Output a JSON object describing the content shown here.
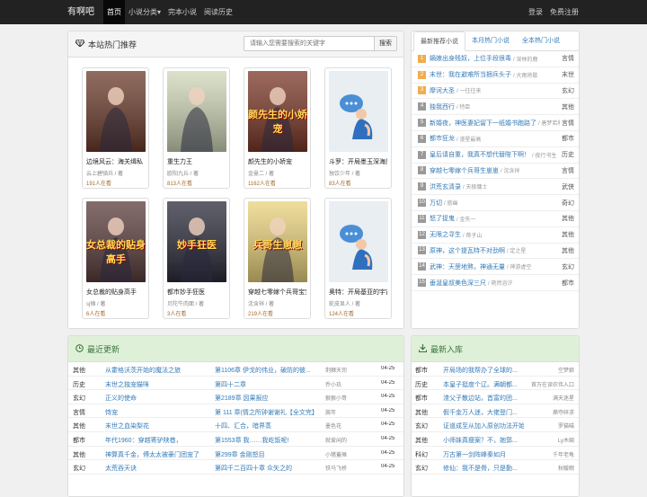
{
  "nav": {
    "brand": "有啊吧",
    "items": [
      "首页",
      "小说分类▾",
      "完本小说",
      "阅读历史"
    ],
    "login": "登录",
    "register": "免费注册"
  },
  "hot": {
    "title": "本站热门推荐",
    "search_placeholder": "请输入您需要搜索的关键字",
    "search_button": "搜索",
    "books": [
      {
        "title": "边境风云：海关缉私",
        "author": "云上碧骑兵 / 著",
        "reads": "191人在看",
        "cover_text": "",
        "bg": "#6b3a2a"
      },
      {
        "title": "重生力王",
        "author": "欧阳九丘 / 著",
        "reads": "813人在看",
        "cover_text": "",
        "bg": "#cfd7b8"
      },
      {
        "title": "颜先生的小娇宠",
        "author": "金曼二 / 著",
        "reads": "1162人在看",
        "cover_text": "颜先生的小娇宠",
        "bg": "#7a3626"
      },
      {
        "title": "斗罗：开局墨玉深海魔鲸",
        "author": "独饮少年 / 著",
        "reads": "83人在看",
        "cover_text": "",
        "bg": "#e9eef3"
      },
      {
        "title": "女总裁的贴身高手",
        "author": "sj傩 / 著",
        "reads": "6人在看",
        "cover_text": "女总裁的贴身高手",
        "bg": "#5a3b3b"
      },
      {
        "title": "都市妙手狂医",
        "author": "贝陀牛肉面 / 著",
        "reads": "3人在看",
        "cover_text": "妙手狂医",
        "bg": "#2a2a3a"
      },
      {
        "title": "穿越七零嫁个兵哥宝宝",
        "author": "沈含祥 / 著",
        "reads": "219人在看",
        "cover_text": "兵哥生崽崽",
        "bg": "#e9d27a"
      },
      {
        "title": "奥特：开局基亚的宇宙",
        "author": "蛇皮显人 / 著",
        "reads": "124人在看",
        "cover_text": "",
        "bg": "#e9eef3"
      }
    ]
  },
  "rank": {
    "tabs": [
      "最新推荐小说",
      "本月热门小说",
      "全本热门小说"
    ],
    "rows": [
      {
        "num": "1",
        "title": "嫡娘出身贱奴，上位手段很毒",
        "author": "深林的鹿",
        "cat": "言情"
      },
      {
        "num": "2",
        "title": "末世：我在避难所当捆兵头子",
        "author": "大雨将歇",
        "cat": "末世"
      },
      {
        "num": "3",
        "title": "摩诃大圣",
        "author": "一往往来",
        "cat": "玄幻"
      },
      {
        "num": "4",
        "title": "独我西行",
        "author": "特臣",
        "cat": "其他"
      },
      {
        "num": "5",
        "title": "新婚夜，神医妻妃留下一纸婚书跑路了",
        "author": "唐梦若和",
        "cat": "言情"
      },
      {
        "num": "6",
        "title": "都市狂龙",
        "author": "漫星最高",
        "cat": "都市"
      },
      {
        "num": "7",
        "title": "皇后请自重，我真不想代替陛下啊！",
        "author": "夜行书生",
        "cat": "历史"
      },
      {
        "num": "8",
        "title": "穿越七零嫁个兵哥生崽崽",
        "author": "沈含祥",
        "cat": "言情"
      },
      {
        "num": "9",
        "title": "洪荒玄清录",
        "author": "天极慵士",
        "cat": "武侠"
      },
      {
        "num": "10",
        "title": "万切",
        "author": "惑幽",
        "cat": "奇幻"
      },
      {
        "num": "11",
        "title": "怒了捉鬼",
        "author": "金失一",
        "cat": "其他"
      },
      {
        "num": "12",
        "title": "无限之寻生",
        "author": "蒋子山",
        "cat": "其他"
      },
      {
        "num": "13",
        "title": "原神，这个提瓦特不对劲啊",
        "author": "定之星",
        "cat": "其他"
      },
      {
        "num": "14",
        "title": "武神：天罡地煞，神通无量",
        "author": "神游虚空",
        "cat": "玄幻"
      },
      {
        "num": "15",
        "title": "垂涎皇叔美色深三尺",
        "author": "艳然浴汐",
        "cat": "都市"
      }
    ]
  },
  "updates": {
    "title": "最近更新",
    "rows": [
      {
        "cat": "其他",
        "book": "从霍格沃茨开始的魔法之旅",
        "chapter": "第1106章 伊戈的伟业，破防的彼...",
        "author": "荆棘天司",
        "date": "04-25"
      },
      {
        "cat": "历史",
        "book": "末世之独宠猫咪",
        "chapter": "第四十二章",
        "author": "乔小玖",
        "date": "04-25"
      },
      {
        "cat": "玄幻",
        "book": "正义的使命",
        "chapter": "第2189章 因果报应",
        "author": "狠狠小哥",
        "date": "04-25"
      },
      {
        "cat": "言情",
        "book": "恃宠",
        "chapter": "第 111 章(情之所钟谢谢礼【全文完】",
        "author": "嵩年",
        "date": "04-25"
      },
      {
        "cat": "其他",
        "book": "末世之血染梨花",
        "chapter": "十四、汇合，暗界蒸",
        "author": "墨色花",
        "date": "04-25"
      },
      {
        "cat": "都市",
        "book": "年代1960：穿越寄驴陕巷，",
        "chapter": "第1553章 我……我屹饭呢!",
        "author": "就爱闲的",
        "date": "04-25"
      },
      {
        "cat": "其他",
        "book": "神算真千金，傅太太被豪门团宠了",
        "chapter": "第299章 金刚怒目",
        "author": "小猪蓋摊",
        "date": "04-25"
      },
      {
        "cat": "玄幻",
        "book": "太荒吞天诀",
        "chapter": "第四千二百四十章 众矢之的",
        "author": "铁马飞桥",
        "date": "04-25"
      }
    ]
  },
  "newbooks": {
    "title": "最新入库",
    "rows": [
      {
        "cat": "都市",
        "book": "开局场的我帮办了全球的...",
        "author": "空梦娘"
      },
      {
        "cat": "历史",
        "book": "本皇子挺度个辽。满朝都...",
        "author": "首万在读农伟入口"
      },
      {
        "cat": "都市",
        "book": "渣父子散边站，首富的团...",
        "author": "满天迷星"
      },
      {
        "cat": "其他",
        "book": "假千金万人迷，大佬登门...",
        "author": "撕夺碎求"
      },
      {
        "cat": "玄幻",
        "book": "证道成至从加入原创功法开始",
        "author": "罗猫喵"
      },
      {
        "cat": "其他",
        "book": "小师妹真瘦案？不，她郭...",
        "author": "Ly木碉"
      },
      {
        "cat": "科幻",
        "book": "万古第一剑阵峰秦如月",
        "author": "千年老龟"
      },
      {
        "cat": "玄幻",
        "book": "修仙：我不是骨，只是勤...",
        "author": "秋暖暇"
      }
    ]
  }
}
